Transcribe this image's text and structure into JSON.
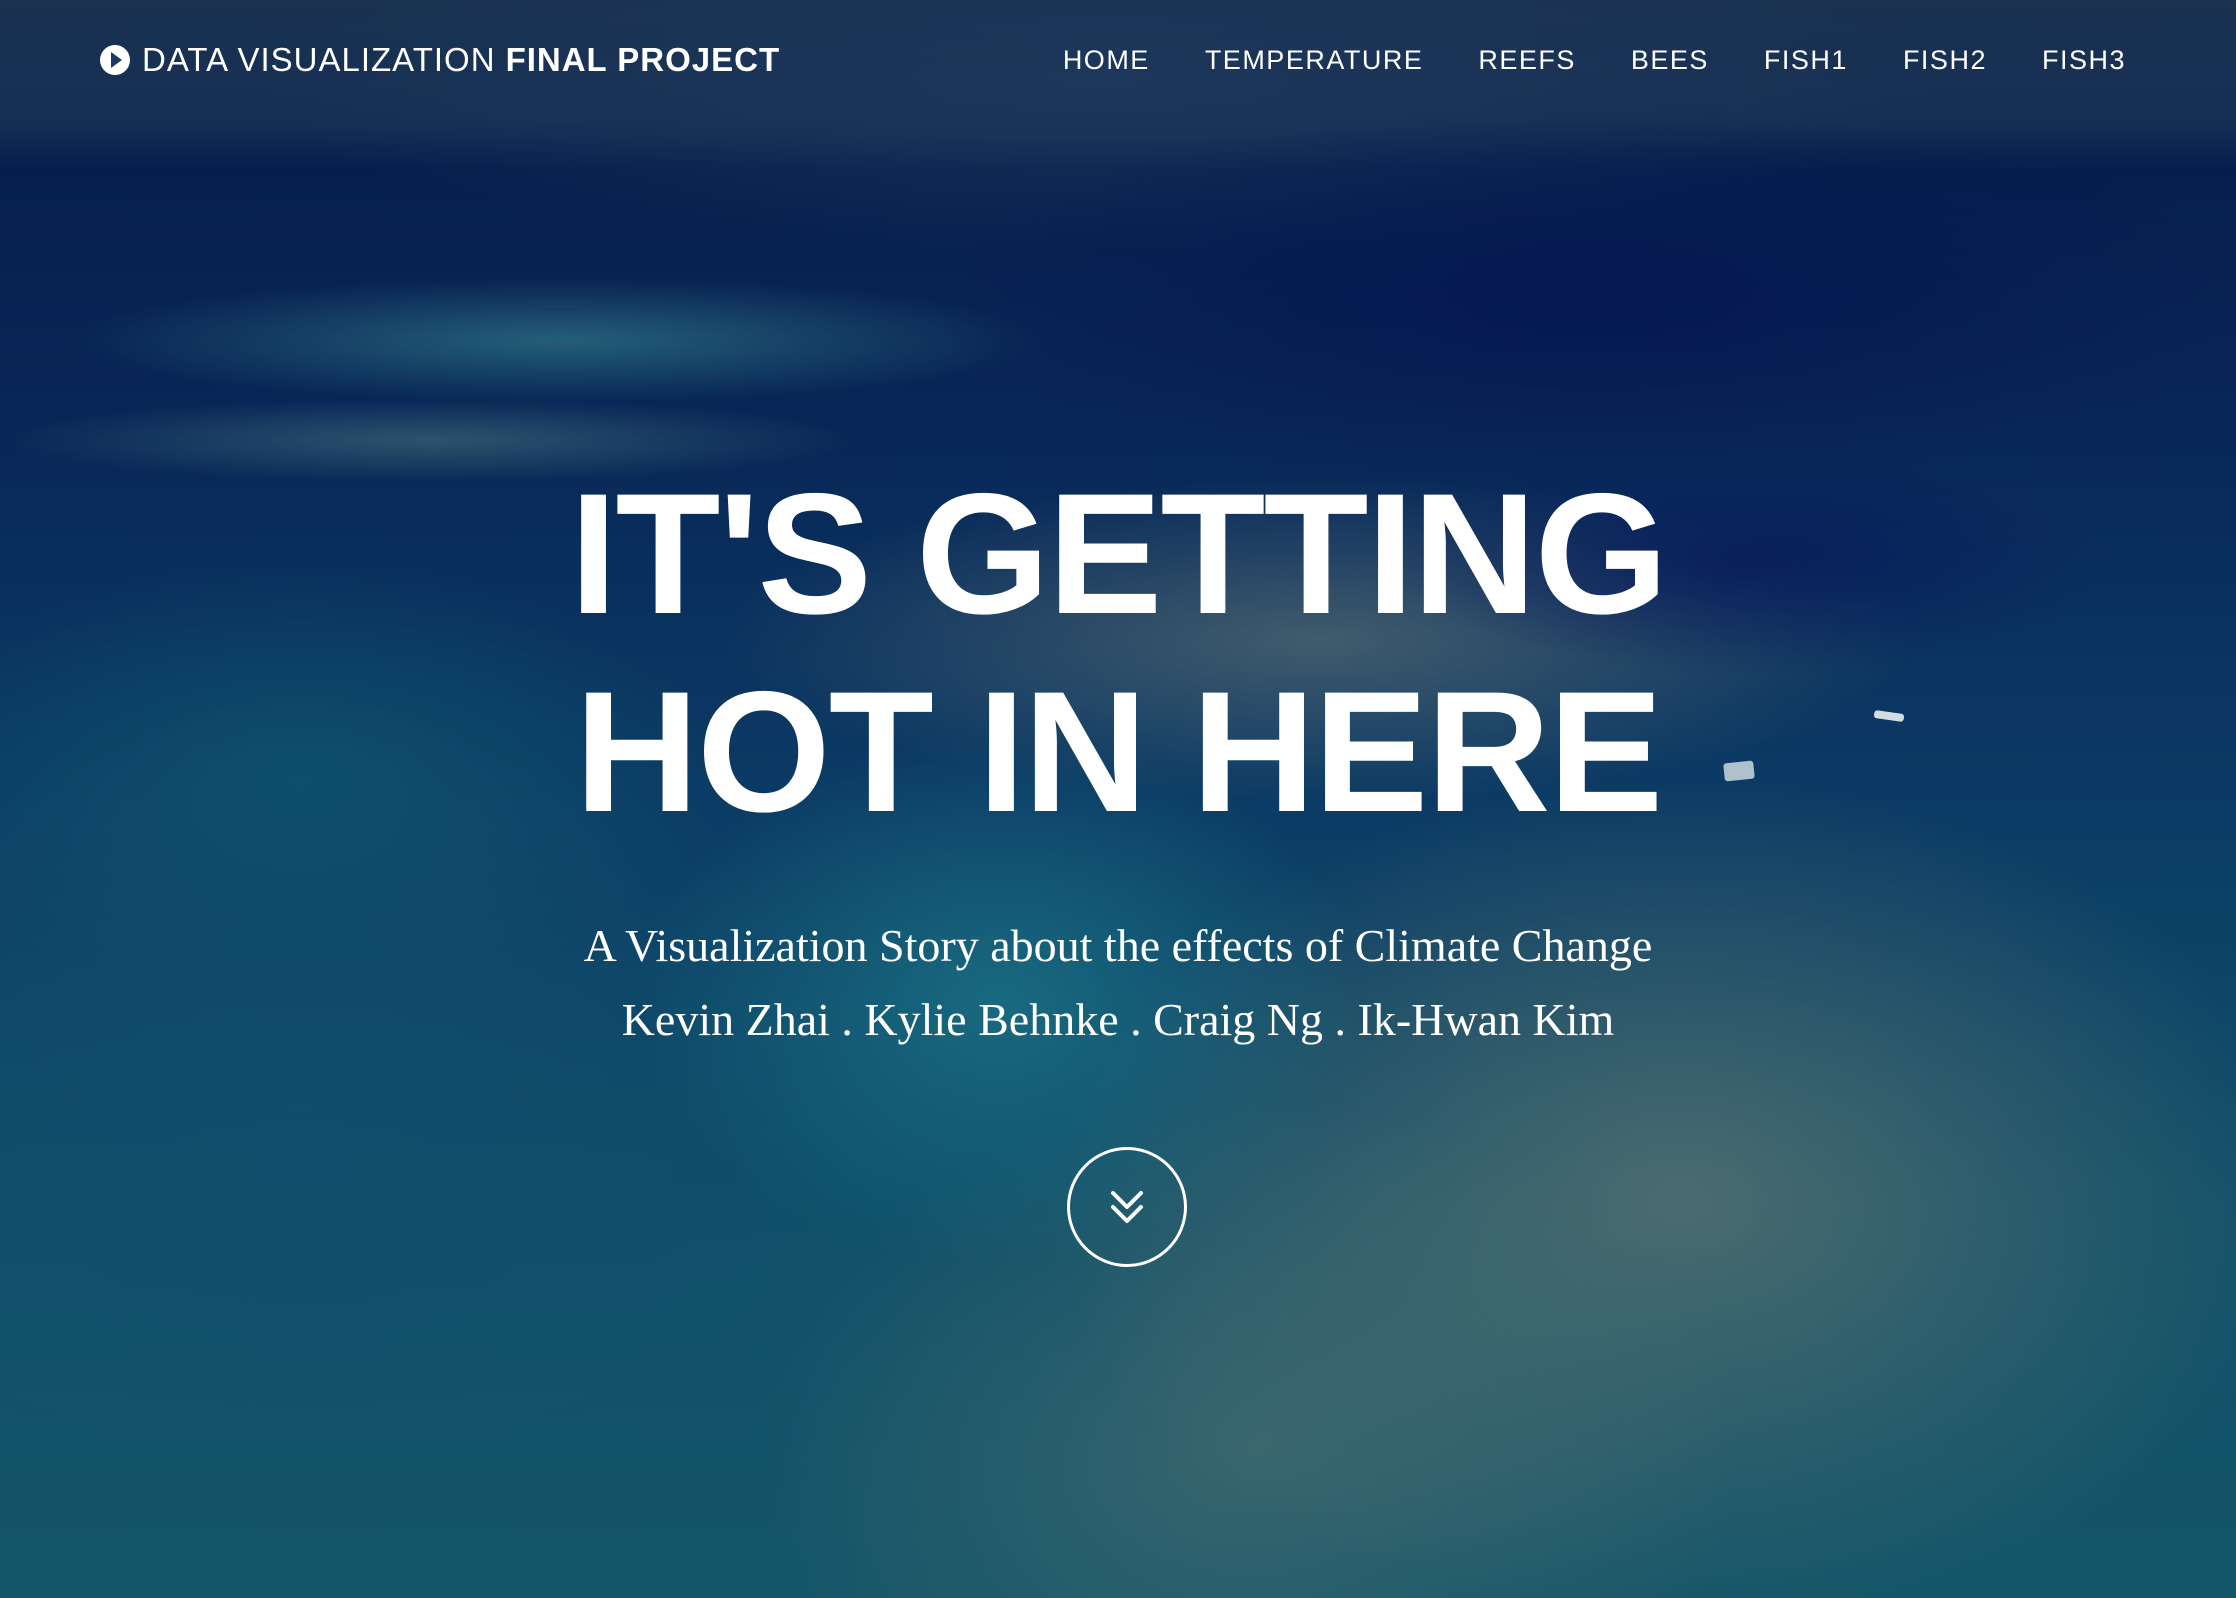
{
  "navbar": {
    "brand_icon": "play-circle-icon",
    "brand_light": "DATA VISUALIZATION",
    "brand_bold": "FINAL PROJECT",
    "links": [
      {
        "label": "HOME"
      },
      {
        "label": "TEMPERATURE"
      },
      {
        "label": "REEFS"
      },
      {
        "label": "BEES"
      },
      {
        "label": "FISH1"
      },
      {
        "label": "FISH2"
      },
      {
        "label": "FISH3"
      }
    ]
  },
  "hero": {
    "title_line1": "IT'S GETTING",
    "title_line2": "HOT IN HERE",
    "subtitle": "A Visualization Story about the effects of Climate Change",
    "authors": "Kevin Zhai . Kylie Behnke . Craig Ng . Ik-Hwan Kim",
    "scroll_icon": "double-chevron-down-icon"
  },
  "colors": {
    "text": "#ffffff",
    "ocean_deep": "#08225a",
    "reef_teal": "#1b6f80"
  }
}
